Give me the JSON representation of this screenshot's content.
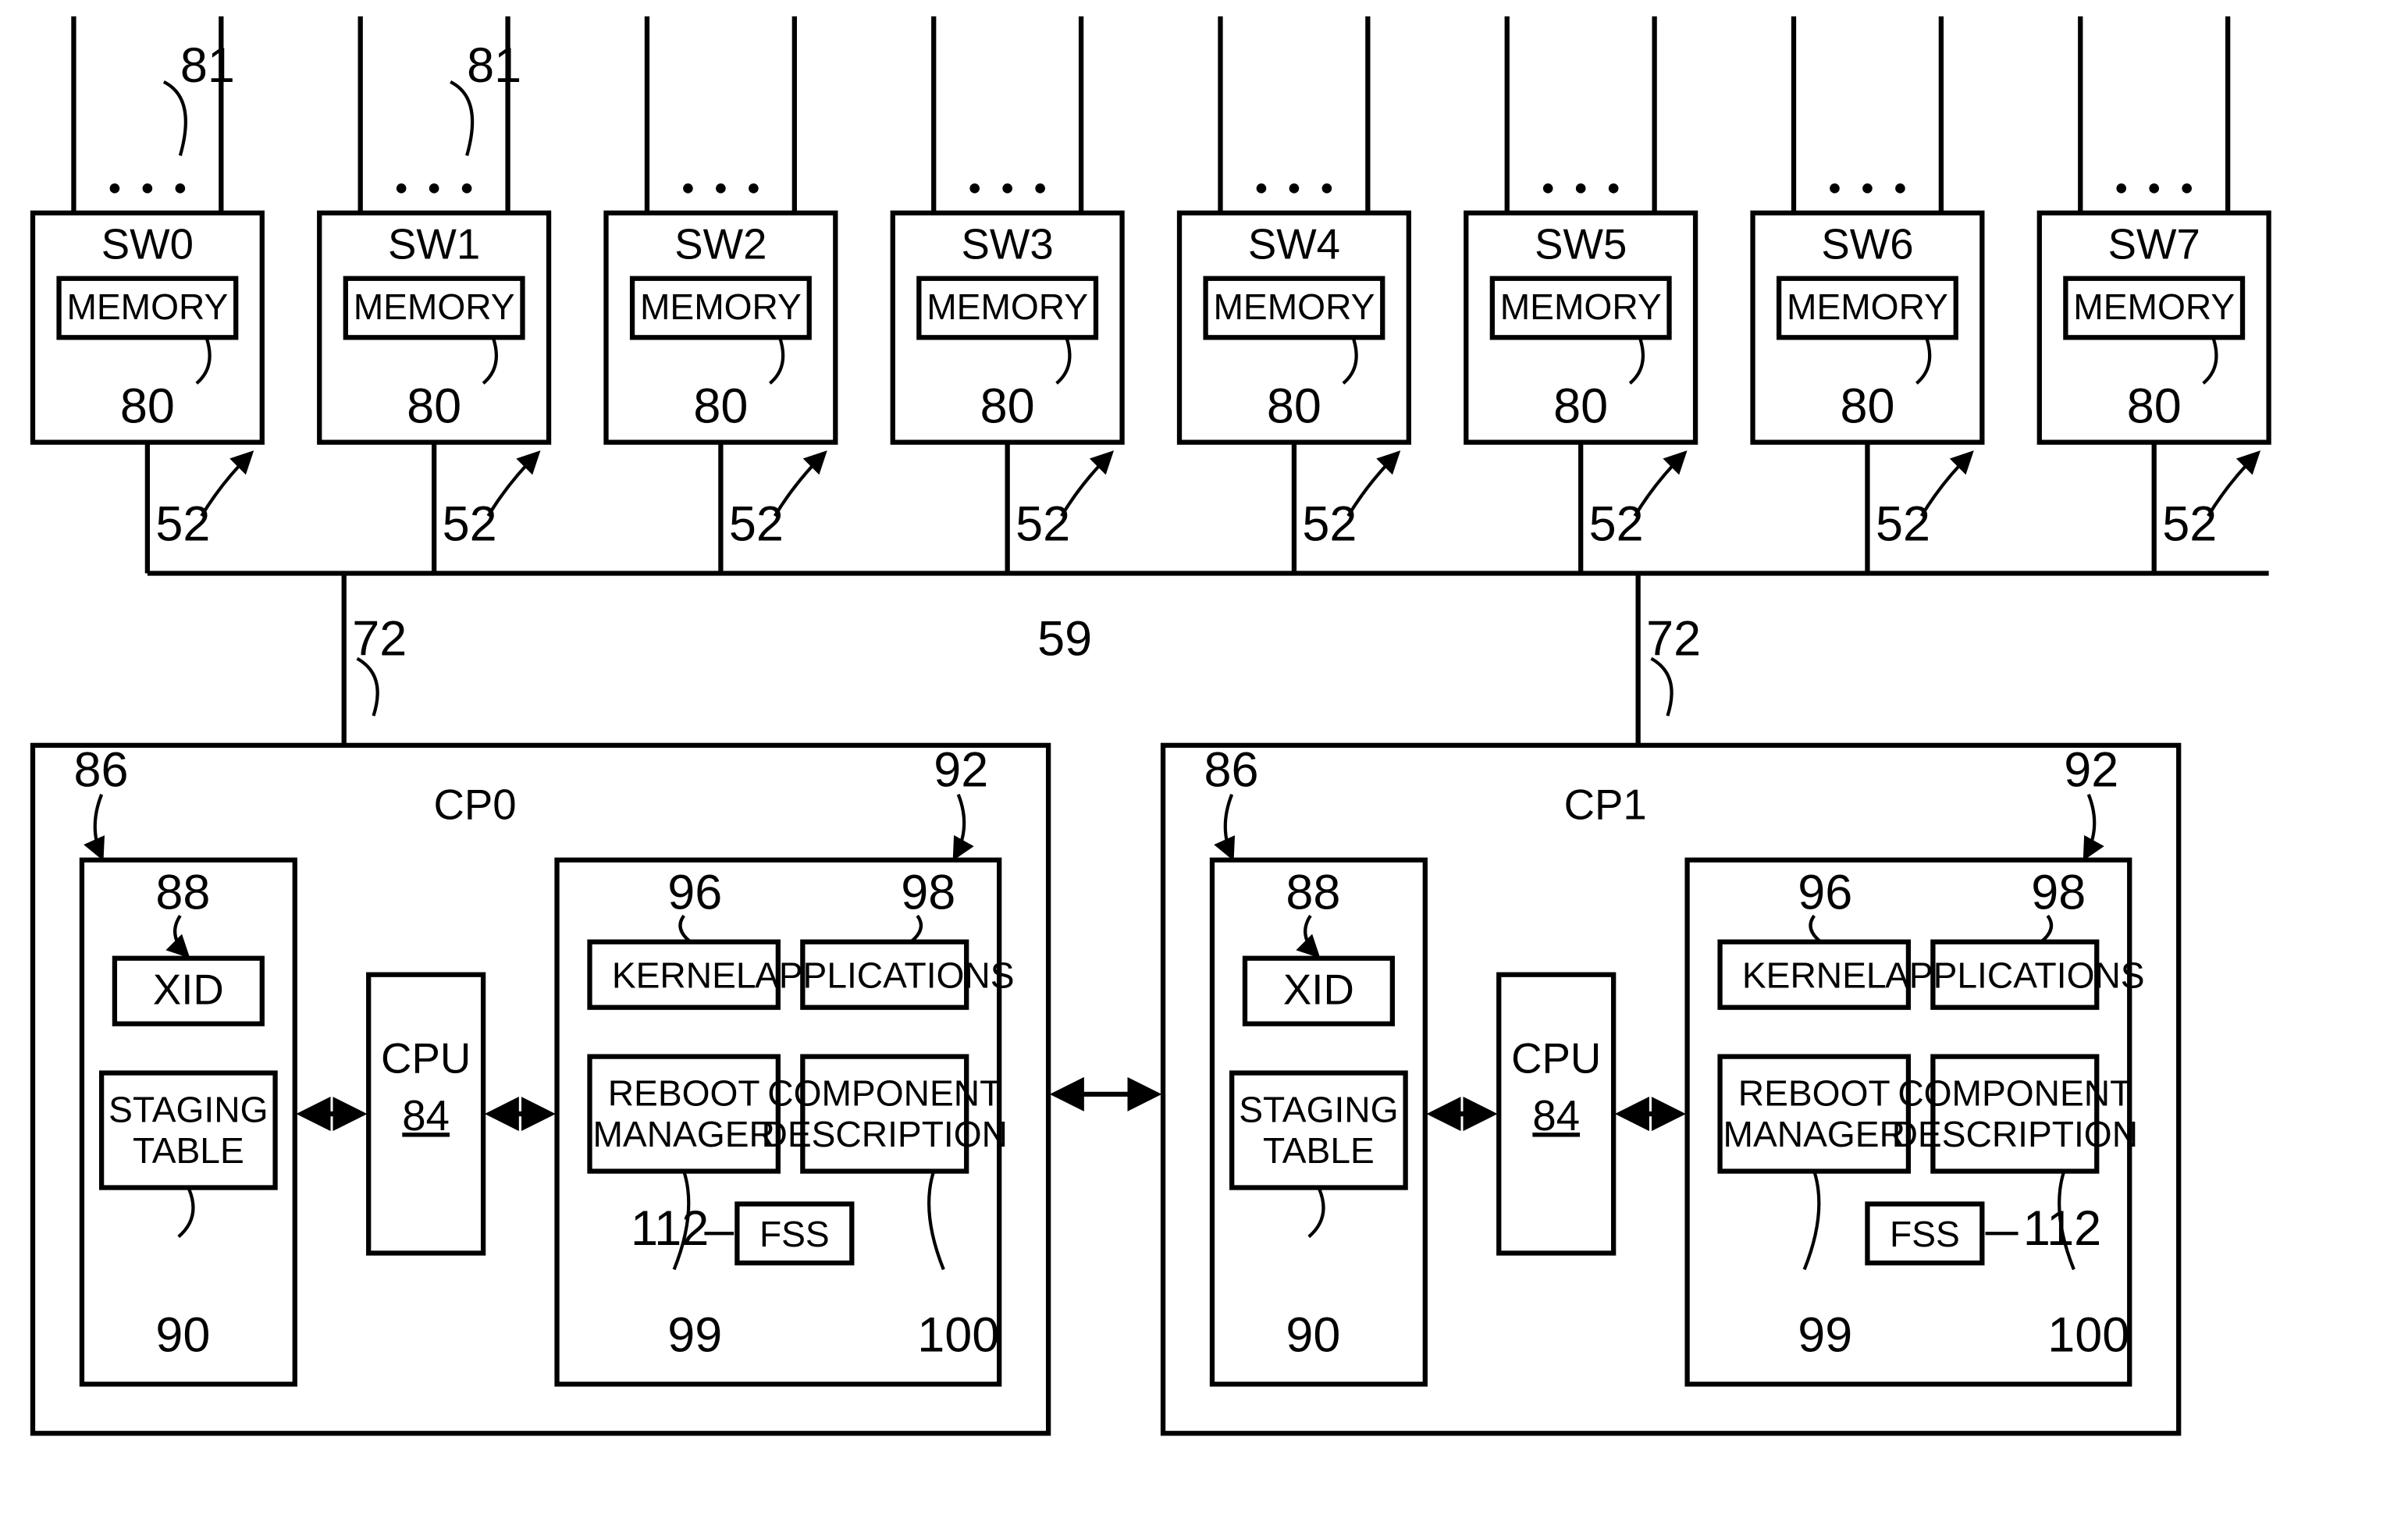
{
  "switches": [
    {
      "title": "SW0",
      "mem": "MEMORY",
      "memref": "80",
      "boxref": "52"
    },
    {
      "title": "SW1",
      "mem": "MEMORY",
      "memref": "80",
      "boxref": "52"
    },
    {
      "title": "SW2",
      "mem": "MEMORY",
      "memref": "80",
      "boxref": "52"
    },
    {
      "title": "SW3",
      "mem": "MEMORY",
      "memref": "80",
      "boxref": "52"
    },
    {
      "title": "SW4",
      "mem": "MEMORY",
      "memref": "80",
      "boxref": "52"
    },
    {
      "title": "SW5",
      "mem": "MEMORY",
      "memref": "80",
      "boxref": "52"
    },
    {
      "title": "SW6",
      "mem": "MEMORY",
      "memref": "80",
      "boxref": "52"
    },
    {
      "title": "SW7",
      "mem": "MEMORY",
      "memref": "80",
      "boxref": "52"
    }
  ],
  "topwires_ref": "81",
  "bus_ref": "59",
  "cp_ref": "72",
  "cp": [
    {
      "title": "CP0"
    },
    {
      "title": "CP1"
    }
  ],
  "cp_common": {
    "leftref": "86",
    "xid": "XID",
    "xidref": "88",
    "staging1": "STAGING",
    "staging2": "TABLE",
    "stagingref": "90",
    "cpu": "CPU",
    "cpuref": "84",
    "rightref": "92",
    "kernel": "KERNEL",
    "kernelref": "96",
    "apps": "APPLICATIONS",
    "appsref": "98",
    "reboot1": "REBOOT",
    "reboot2": "MANAGER",
    "rebootref": "99",
    "comp1": "COMPONENT",
    "comp2": "DESCRIPTION",
    "compref": "100",
    "fss": "FSS",
    "fssref": "112"
  }
}
